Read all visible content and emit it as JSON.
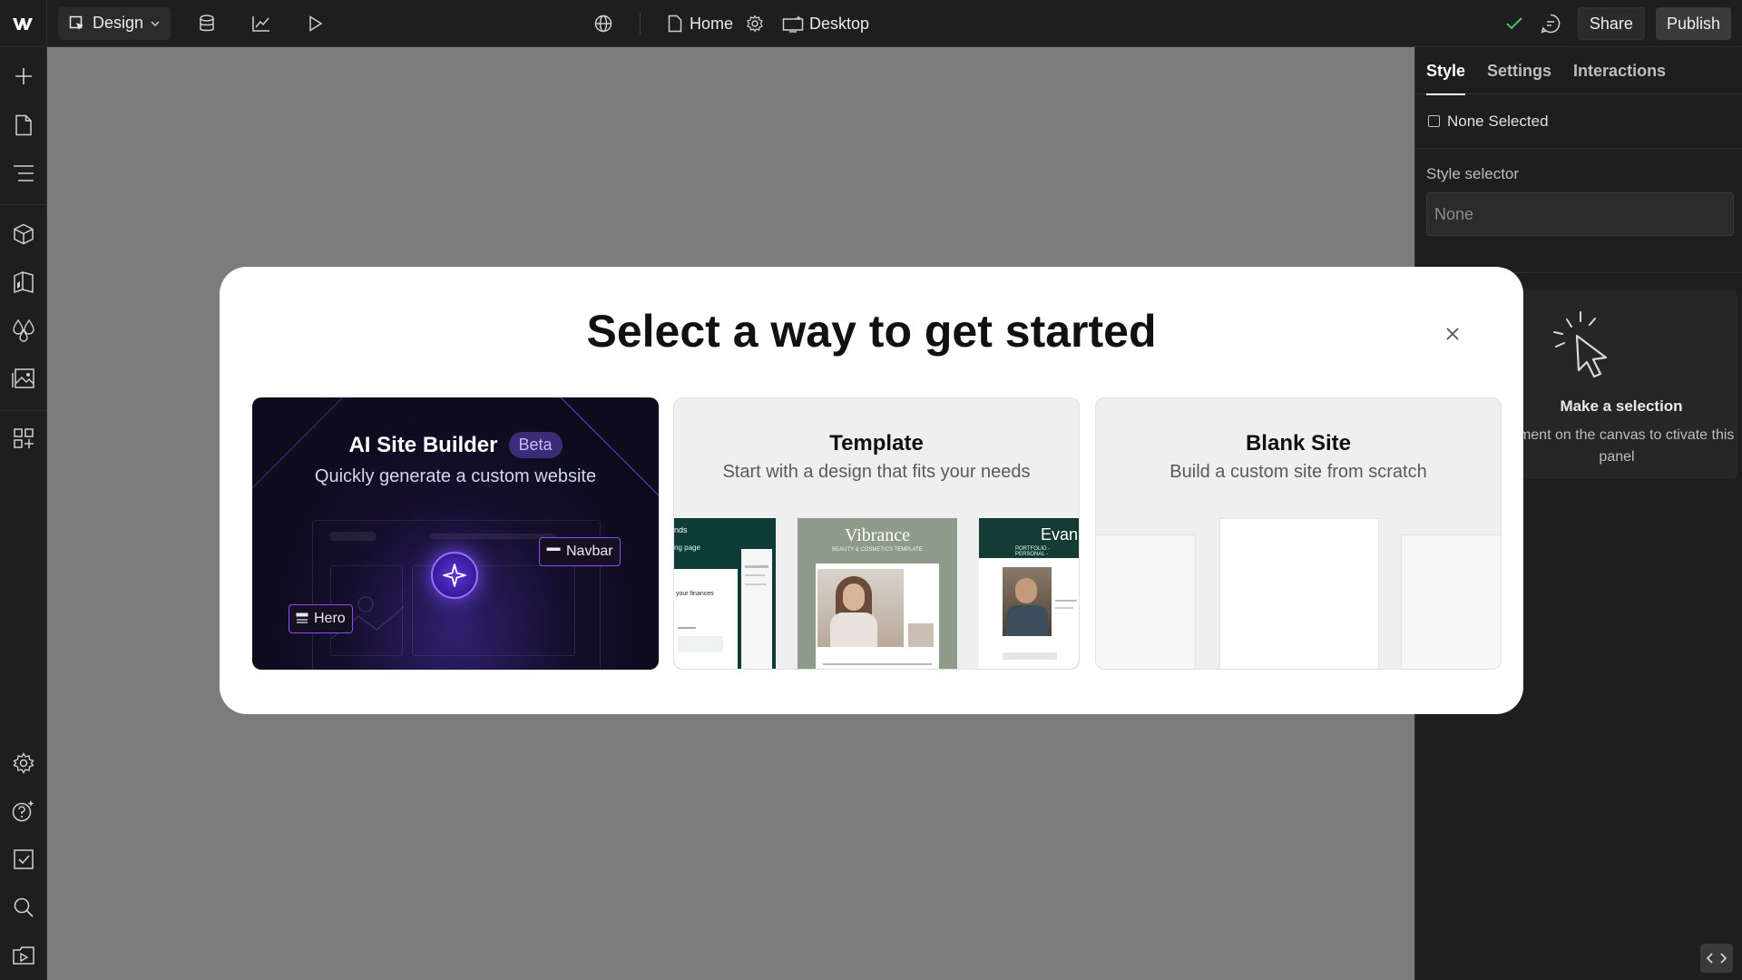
{
  "topbar": {
    "mode_label": "Design",
    "page_label": "Home",
    "breakpoint_label": "Desktop",
    "share_label": "Share",
    "publish_label": "Publish"
  },
  "leftbar": {
    "icons": [
      "add-icon",
      "pages-icon",
      "navigator-icon",
      "components-icon",
      "style-manager-icon",
      "variables-icon",
      "assets-icon",
      "apps-icon",
      "settings-icon",
      "help-icon",
      "audit-icon",
      "search-icon",
      "video-tutorials-icon"
    ]
  },
  "right_panel": {
    "tabs": [
      "Style",
      "Settings",
      "Interactions"
    ],
    "none_selected": "None Selected",
    "style_selector_label": "Style selector",
    "style_selector_placeholder": "None",
    "selection_title": "Make a selection",
    "selection_text": "element on the canvas to ctivate this panel"
  },
  "modal": {
    "title": "Select a way to get started",
    "cards": {
      "ai": {
        "title": "AI Site Builder",
        "badge": "Beta",
        "subtitle": "Quickly generate a custom website",
        "tag_navbar": "Navbar",
        "tag_hero": "Hero"
      },
      "template": {
        "title": "Template",
        "subtitle": "Start with a design that fits your needs",
        "thumb_left_text1": "nds",
        "thumb_left_text2": "ng page",
        "thumb_left_text3": "your finances",
        "thumb_center_title": "Vibrance",
        "thumb_center_sub": "BEAUTY & COSMETICS TEMPLATE",
        "thumb_right_title": "Evan",
        "thumb_right_sub": "PORTFOLIO - PERSONAL -"
      },
      "blank": {
        "title": "Blank Site",
        "subtitle": "Build a custom site from scratch"
      }
    }
  },
  "colors": {
    "accent_purple": "#8c4bff",
    "check_green": "#4fc05c",
    "canvas_gray": "#7c7c7c"
  }
}
